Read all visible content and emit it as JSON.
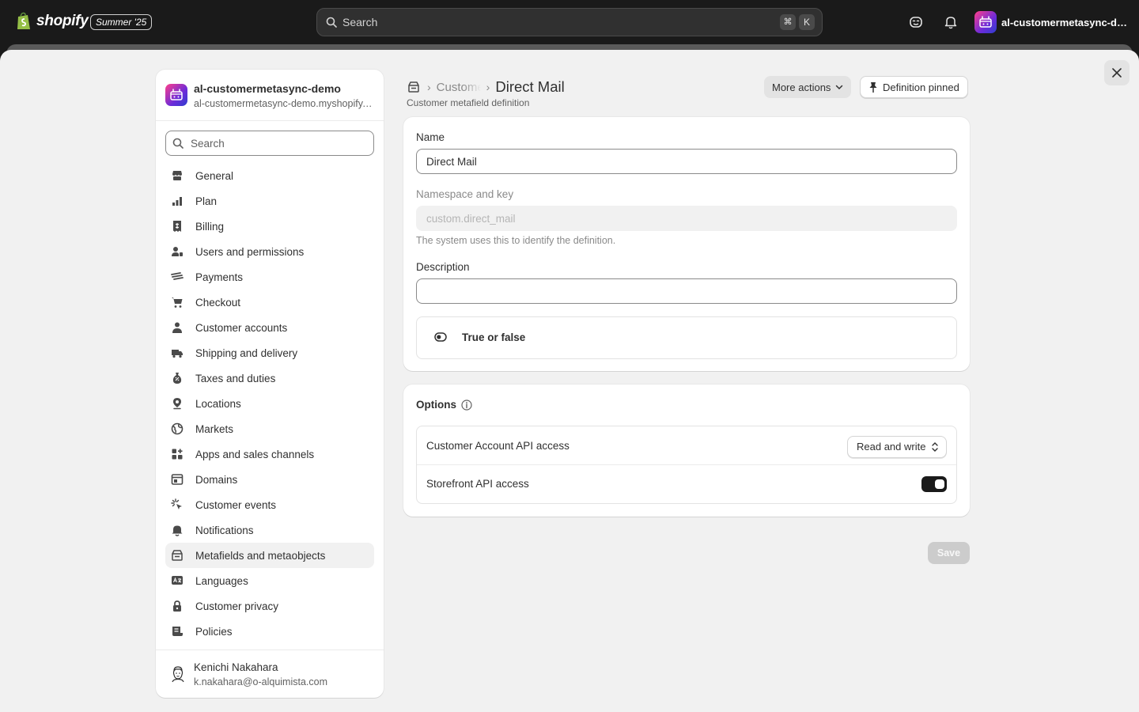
{
  "topbar": {
    "logo_text": "shopify",
    "edition_badge": "Summer '25",
    "search_placeholder": "Search",
    "shortcut_cmd": "⌘",
    "shortcut_key": "K",
    "store_name": "al-customermetasync-de..."
  },
  "sidebar": {
    "store_name": "al-customermetasync-demo",
    "store_domain": "al-customermetasync-demo.myshopify.com",
    "search_placeholder": "Search",
    "items": [
      {
        "label": "General",
        "icon": "store-icon"
      },
      {
        "label": "Plan",
        "icon": "plan-icon"
      },
      {
        "label": "Billing",
        "icon": "receipt-icon"
      },
      {
        "label": "Users and permissions",
        "icon": "users-icon"
      },
      {
        "label": "Payments",
        "icon": "payments-icon"
      },
      {
        "label": "Checkout",
        "icon": "cart-icon"
      },
      {
        "label": "Customer accounts",
        "icon": "person-icon"
      },
      {
        "label": "Shipping and delivery",
        "icon": "truck-icon"
      },
      {
        "label": "Taxes and duties",
        "icon": "tax-icon"
      },
      {
        "label": "Locations",
        "icon": "location-icon"
      },
      {
        "label": "Markets",
        "icon": "globe-icon"
      },
      {
        "label": "Apps and sales channels",
        "icon": "apps-icon"
      },
      {
        "label": "Domains",
        "icon": "domain-icon"
      },
      {
        "label": "Customer events",
        "icon": "cursor-icon"
      },
      {
        "label": "Notifications",
        "icon": "bell-icon"
      },
      {
        "label": "Metafields and metaobjects",
        "icon": "metafields-icon",
        "active": true
      },
      {
        "label": "Languages",
        "icon": "language-icon"
      },
      {
        "label": "Customer privacy",
        "icon": "lock-icon"
      },
      {
        "label": "Policies",
        "icon": "policy-icon"
      }
    ],
    "user": {
      "name": "Kenichi Nakahara",
      "email": "k.nakahara@o-alquimista.com"
    }
  },
  "header": {
    "breadcrumb_parent": "Customers",
    "title": "Direct Mail",
    "subtitle": "Customer metafield definition",
    "more_actions_label": "More actions",
    "pinned_label": "Definition pinned"
  },
  "form": {
    "name_label": "Name",
    "name_value": "Direct Mail",
    "namespace_label": "Namespace and key",
    "namespace_value": "custom.direct_mail",
    "namespace_help": "The system uses this to identify the definition.",
    "description_label": "Description",
    "description_value": "",
    "type_label": "True or false"
  },
  "options": {
    "title": "Options",
    "customer_account_api_label": "Customer Account API access",
    "customer_account_api_value": "Read and write",
    "storefront_api_label": "Storefront API access",
    "storefront_api_enabled": true
  },
  "footer": {
    "save_label": "Save"
  },
  "colors": {
    "topbar_bg": "#1a1a1a",
    "modal_bg": "#f1f1f1",
    "toggle_on": "#1a1a1a",
    "save_disabled": "#cccccc"
  }
}
